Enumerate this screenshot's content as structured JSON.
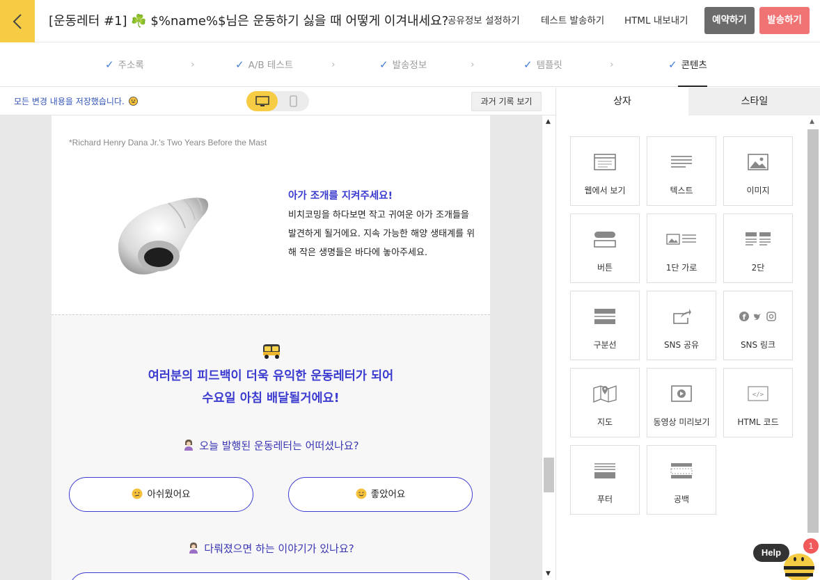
{
  "header": {
    "title": "[운동레터 #1] ☘️ $%name%$님은 운동하기 싫을 때 어떻게 이겨내세요?",
    "links": [
      "공유정보 설정하기",
      "테스트 발송하기",
      "HTML 내보내기"
    ],
    "reserve_label": "예약하기",
    "send_label": "발송하기"
  },
  "steps": [
    {
      "label": "주소록"
    },
    {
      "label": "A/B 테스트"
    },
    {
      "label": "발송정보"
    },
    {
      "label": "템플릿"
    },
    {
      "label": "콘텐츠"
    }
  ],
  "toolbar": {
    "saved_text": "모든 변경 내용을 저장했습니다.",
    "history_label": "과거 기록 보기"
  },
  "email": {
    "quote": "*Richard Henry Dana Jr.'s Two Years Before the Mast",
    "shell_title": "아가 조개를 지켜주세요!",
    "shell_body": "비치코밍을 하다보면 작고 귀여운 아가 조개들을 발견하게 될거에요. 지속 가능한 해양 생태계를 위해 작은 생명들은 바다에 놓아주세요.",
    "feedback_line1": "여러분의 피드백이 더욱 유익한 운동레터가 되어",
    "feedback_line2": "수요일 아침 배달될거에요!",
    "question1": "오늘 발행된 운동레터는 어떠셨나요?",
    "answer_bad": "아쉬웠어요",
    "answer_good": "좋았어요",
    "question2": "다뤄졌으면 하는 이야기가 있나요?"
  },
  "panel": {
    "tab_blocks": "상자",
    "tab_style": "스타일",
    "tiles": [
      {
        "label": "웹에서 보기",
        "icon": "browser-icon"
      },
      {
        "label": "텍스트",
        "icon": "text-lines-icon"
      },
      {
        "label": "이미지",
        "icon": "image-icon"
      },
      {
        "label": "버튼",
        "icon": "button-icon"
      },
      {
        "label": "1단 가로",
        "icon": "image-text-row-icon"
      },
      {
        "label": "2단",
        "icon": "two-column-icon"
      },
      {
        "label": "구분선",
        "icon": "divider-icon"
      },
      {
        "label": "SNS 공유",
        "icon": "share-icon"
      },
      {
        "label": "SNS 링크",
        "icon": "social-links-icon"
      },
      {
        "label": "지도",
        "icon": "map-icon"
      },
      {
        "label": "동영상 미리보기",
        "icon": "video-icon"
      },
      {
        "label": "HTML 코드",
        "icon": "code-icon"
      },
      {
        "label": "푸터",
        "icon": "footer-icon"
      },
      {
        "label": "공백",
        "icon": "spacer-icon"
      }
    ]
  },
  "help": {
    "label": "Help",
    "badge": "1"
  },
  "colors": {
    "accent_yellow": "#f7cc45",
    "send_red": "#f07474",
    "reserve_gray": "#6b6b6b",
    "email_blue": "#3b3bd0"
  }
}
